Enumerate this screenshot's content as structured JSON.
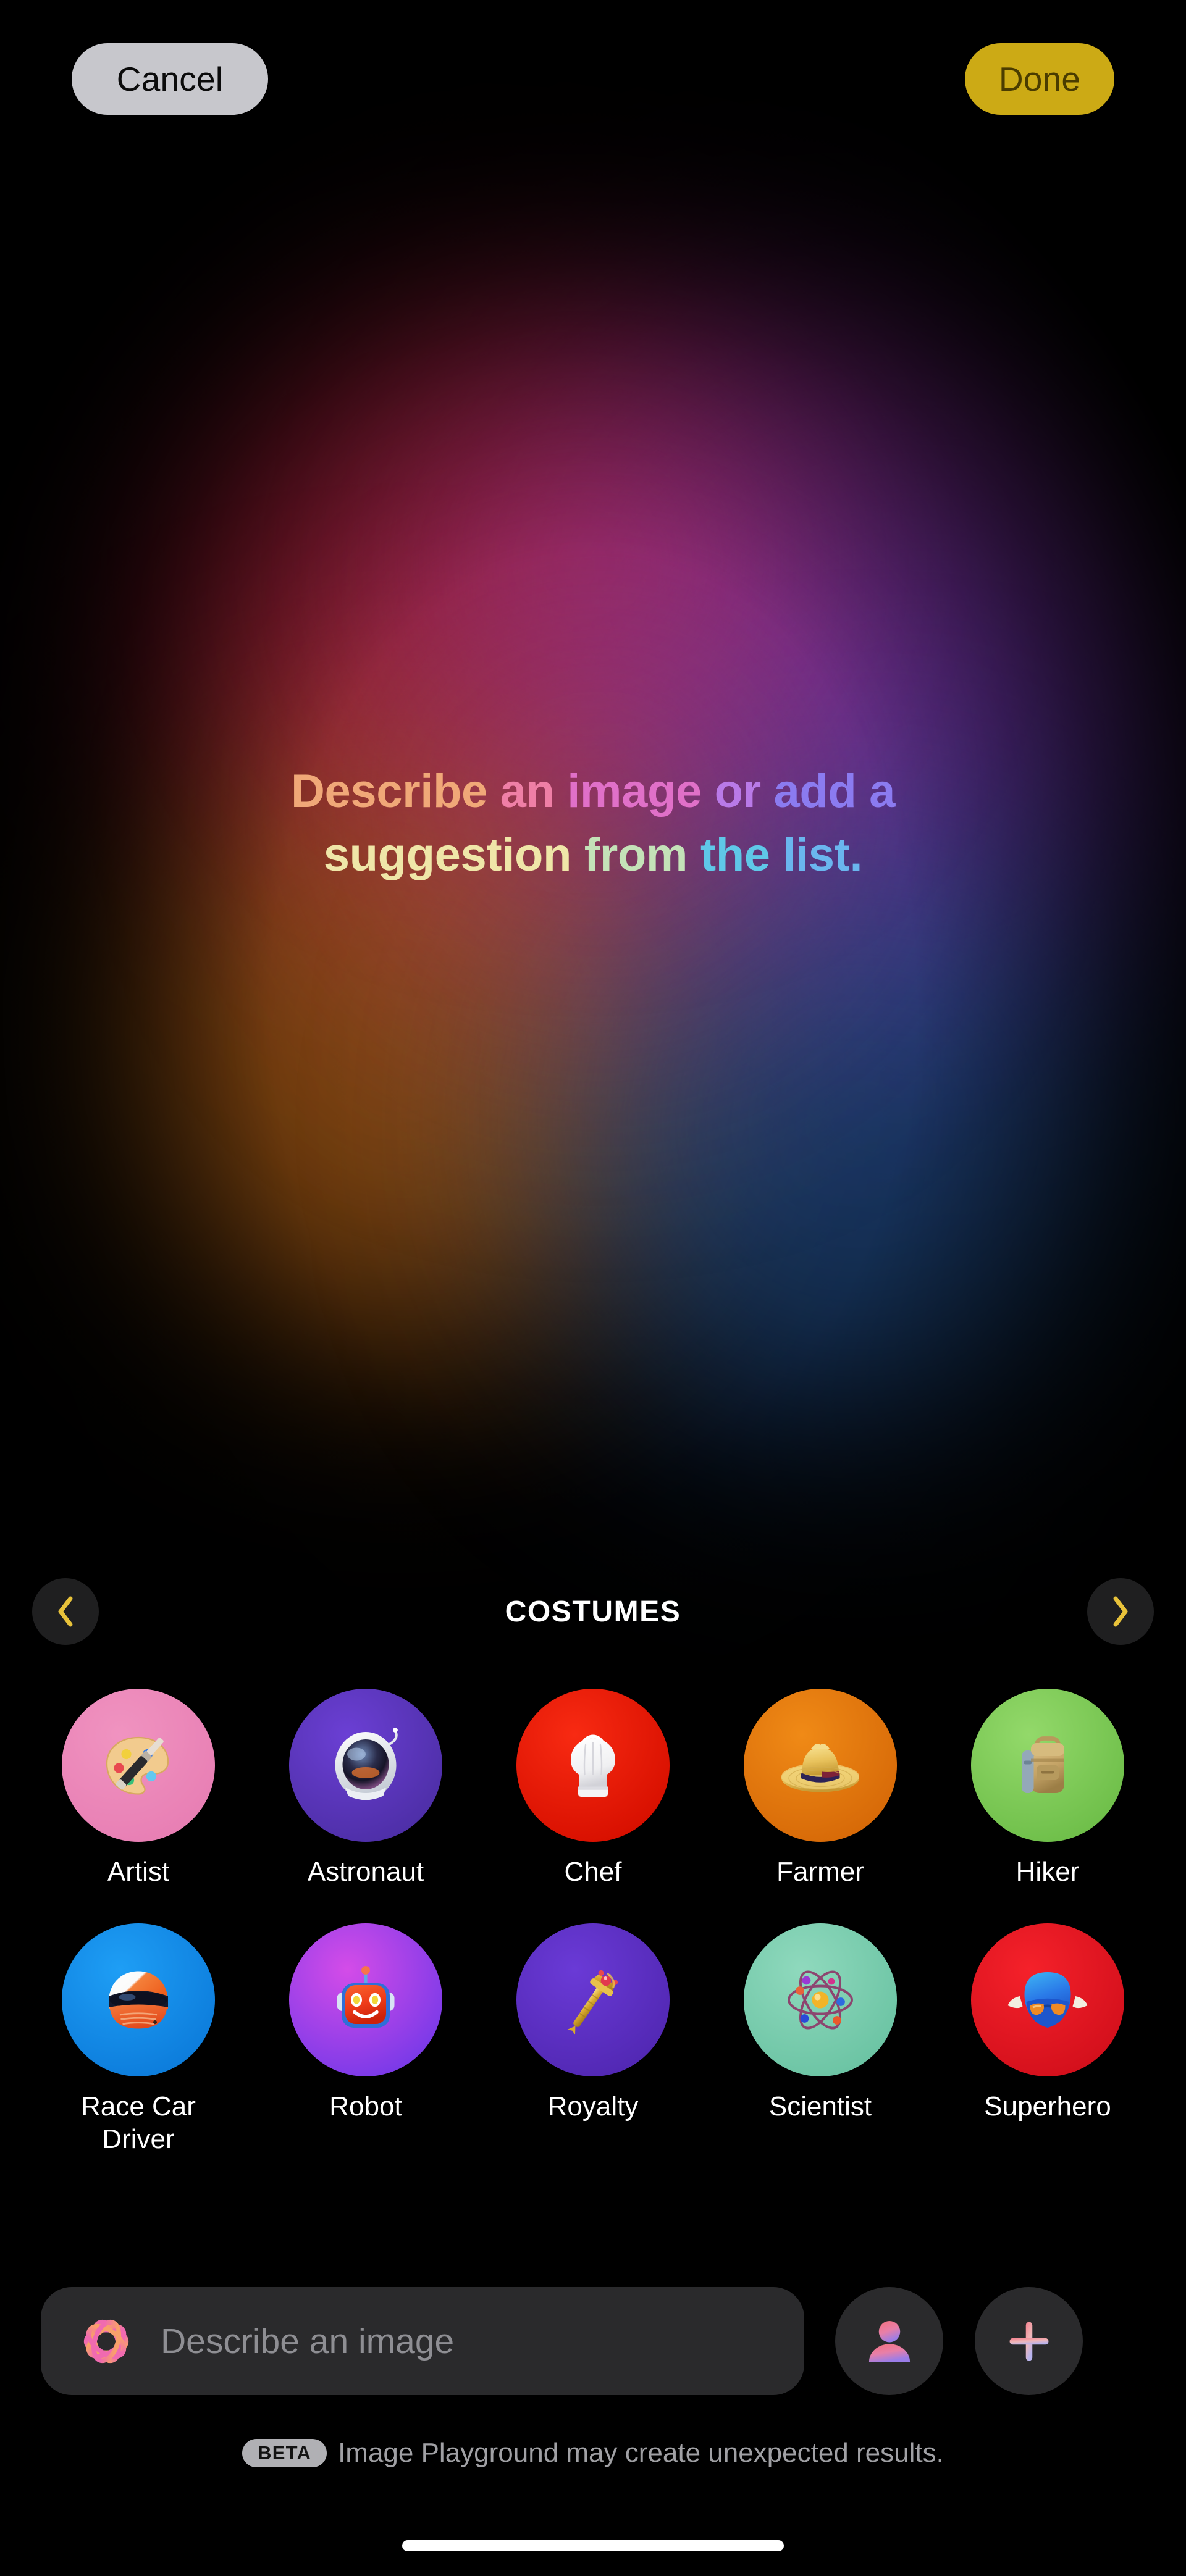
{
  "topbar": {
    "cancel_label": "Cancel",
    "done_label": "Done",
    "cancel_bg": "#c7c7cc",
    "done_bg": "#ccaa15"
  },
  "headline": {
    "full_text": "Describe an image or add a suggestion from the list.",
    "segments": [
      {
        "text": "Describe ",
        "color": "#f0a878"
      },
      {
        "text": "an ",
        "color": "#ef7fa6"
      },
      {
        "text": "image ",
        "color": "#e070c8"
      },
      {
        "text": "or ",
        "color": "#b97ae8"
      },
      {
        "text": "add a",
        "color": "#8b7bf0"
      },
      {
        "text": "suggestion ",
        "color": "#efe6a8"
      },
      {
        "text": "from ",
        "color": "#c4e2b8"
      },
      {
        "text": "the ",
        "color": "#5fc8e8"
      },
      {
        "text": "list.",
        "color": "#6ab6ee"
      }
    ]
  },
  "category": {
    "title": "COSTUMES",
    "prev_label": "Previous category",
    "next_label": "Next category",
    "arrow_color": "#e8c23a"
  },
  "costumes": [
    {
      "label": "Artist",
      "icon": "palette-icon",
      "bg_from": "#f093c0",
      "bg_to": "#e87fb4"
    },
    {
      "label": "Astronaut",
      "icon": "space-helmet-icon",
      "bg_from": "#6b3fd4",
      "bg_to": "#4e2fa8"
    },
    {
      "label": "Chef",
      "icon": "chef-hat-icon",
      "bg_from": "#f82a12",
      "bg_to": "#d81000"
    },
    {
      "label": "Farmer",
      "icon": "straw-hat-icon",
      "bg_from": "#f08a16",
      "bg_to": "#d76a08"
    },
    {
      "label": "Hiker",
      "icon": "backpack-icon",
      "bg_from": "#93d96a",
      "bg_to": "#6fbf4a"
    },
    {
      "label": "Race Car Driver",
      "icon": "racing-helmet-icon",
      "bg_from": "#1e9ef5",
      "bg_to": "#0d7ddc"
    },
    {
      "label": "Robot",
      "icon": "robot-head-icon",
      "bg_from": "#d44ce8",
      "bg_to": "#7b3ae8"
    },
    {
      "label": "Royalty",
      "icon": "scepter-icon",
      "bg_from": "#6a3ad6",
      "bg_to": "#5228b4"
    },
    {
      "label": "Scientist",
      "icon": "atom-icon",
      "bg_from": "#8fd9bd",
      "bg_to": "#6cc4a4"
    },
    {
      "label": "Superhero",
      "icon": "hero-mask-icon",
      "bg_from": "#f5212a",
      "bg_to": "#d4101c"
    }
  ],
  "input": {
    "placeholder": "Describe an image",
    "value": "",
    "logo_name": "apple-intelligence-logo",
    "person_label": "Add a person",
    "add_label": "Add"
  },
  "footer": {
    "beta_badge": "BETA",
    "disclaimer": "Image Playground may create unexpected results."
  }
}
